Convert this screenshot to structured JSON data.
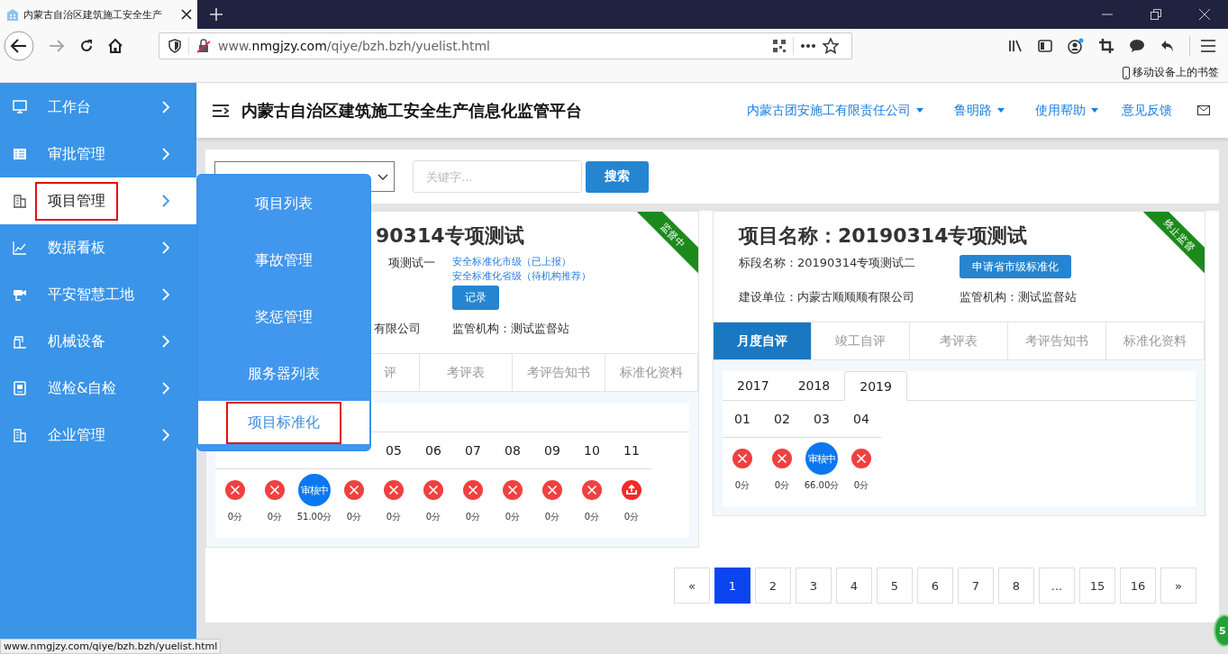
{
  "browser": {
    "tab": {
      "title": "内蒙古自治区建筑施工安全生产"
    },
    "url": {
      "prefix": "www.",
      "domain": "nmgjzy.com",
      "path": "/qiye/bzh.bzh/yuelist.html"
    },
    "bookmarks": [
      "移动设备上的书签"
    ],
    "status_url": "www.nmgjzy.com/qiye/bzh.bzh/yuelist.html"
  },
  "sidebar": {
    "items": [
      {
        "label": "工作台",
        "selected": false
      },
      {
        "label": "审批管理",
        "selected": false
      },
      {
        "label": "项目管理",
        "selected": true
      },
      {
        "label": "数据看板",
        "selected": false
      },
      {
        "label": "平安智慧工地",
        "selected": false
      },
      {
        "label": "机械设备",
        "selected": false
      },
      {
        "label": "巡检&自检",
        "selected": false
      },
      {
        "label": "企业管理",
        "selected": false
      }
    ]
  },
  "flyout_menu": {
    "items": [
      {
        "label": "项目列表",
        "selected": false
      },
      {
        "label": "事故管理",
        "selected": false
      },
      {
        "label": "奖惩管理",
        "selected": false
      },
      {
        "label": "服务器列表",
        "selected": false
      },
      {
        "label": "项目标准化",
        "selected": true
      }
    ]
  },
  "header": {
    "title": "内蒙古自治区建筑施工安全生产信息化监管平台",
    "nav": [
      {
        "label": "内蒙古团安施工有限责任公司",
        "dropdown": true
      },
      {
        "label": "鲁明路",
        "dropdown": true
      },
      {
        "label": "使用帮助",
        "dropdown": true
      },
      {
        "label": "意见反馈",
        "dropdown": false
      }
    ]
  },
  "filter": {
    "search_placeholder": "关键字...",
    "search_button": "搜索"
  },
  "cards": [
    {
      "ribbon": "监督中",
      "title": "90314专项测试",
      "section": "项测试一",
      "links": [
        "安全标准化市级（已上报）",
        "安全标准化省级（待机构推荐）"
      ],
      "button": "记录",
      "builder": "有限公司",
      "supervisor": "监管机构：测试监督站",
      "tabs": [
        {
          "label": "评",
          "selected": false
        },
        {
          "label": "考评表",
          "selected": false
        },
        {
          "label": "考评告知书",
          "selected": false
        },
        {
          "label": "标准化资料",
          "selected": false
        }
      ],
      "months": [
        {
          "kind": "rejected",
          "score": "0分"
        },
        {
          "kind": "rejected",
          "score": "0分"
        },
        {
          "kind": "reviewing",
          "badge": "审核中",
          "score": "51.00分"
        },
        {
          "kind": "rejected",
          "score": "0分"
        },
        {
          "label": "05",
          "kind": "rejected",
          "score": "0分"
        },
        {
          "label": "06",
          "kind": "rejected",
          "score": "0分"
        },
        {
          "label": "07",
          "kind": "rejected",
          "score": "0分"
        },
        {
          "label": "08",
          "kind": "rejected",
          "score": "0分"
        },
        {
          "label": "09",
          "kind": "rejected",
          "score": "0分"
        },
        {
          "label": "10",
          "kind": "rejected",
          "score": "0分"
        },
        {
          "label": "11",
          "kind": "upload",
          "score": "0分"
        }
      ]
    },
    {
      "ribbon": "终止监督",
      "title": "项目名称：20190314专项测试",
      "section": "标段名称：20190314专项测试二",
      "button": "申请省市级标准化",
      "builder": "建设单位：内蒙古顺顺顺有限公司",
      "supervisor": "监管机构：测试监督站",
      "tabs": [
        {
          "label": "月度自评",
          "selected": true
        },
        {
          "label": "竣工自评",
          "selected": false
        },
        {
          "label": "考评表",
          "selected": false
        },
        {
          "label": "考评告知书",
          "selected": false
        },
        {
          "label": "标准化资料",
          "selected": false
        }
      ],
      "years": [
        {
          "label": "2017",
          "selected": false
        },
        {
          "label": "2018",
          "selected": false
        },
        {
          "label": "2019",
          "selected": true
        }
      ],
      "months": [
        {
          "label": "01",
          "kind": "rejected",
          "score": "0分"
        },
        {
          "label": "02",
          "kind": "rejected",
          "score": "0分"
        },
        {
          "label": "03",
          "kind": "reviewing",
          "badge": "审核中",
          "score": "66.00分"
        },
        {
          "label": "04",
          "kind": "rejected",
          "score": "0分"
        }
      ]
    }
  ],
  "pagination": [
    {
      "label": "«",
      "selected": false
    },
    {
      "label": "1",
      "selected": true
    },
    {
      "label": "2",
      "selected": false
    },
    {
      "label": "3",
      "selected": false
    },
    {
      "label": "4",
      "selected": false
    },
    {
      "label": "5",
      "selected": false
    },
    {
      "label": "6",
      "selected": false
    },
    {
      "label": "7",
      "selected": false
    },
    {
      "label": "8",
      "selected": false
    },
    {
      "label": "...",
      "selected": false
    },
    {
      "label": "15",
      "selected": false
    },
    {
      "label": "16",
      "selected": false
    },
    {
      "label": "»",
      "selected": false
    }
  ],
  "floating_badge": "5"
}
